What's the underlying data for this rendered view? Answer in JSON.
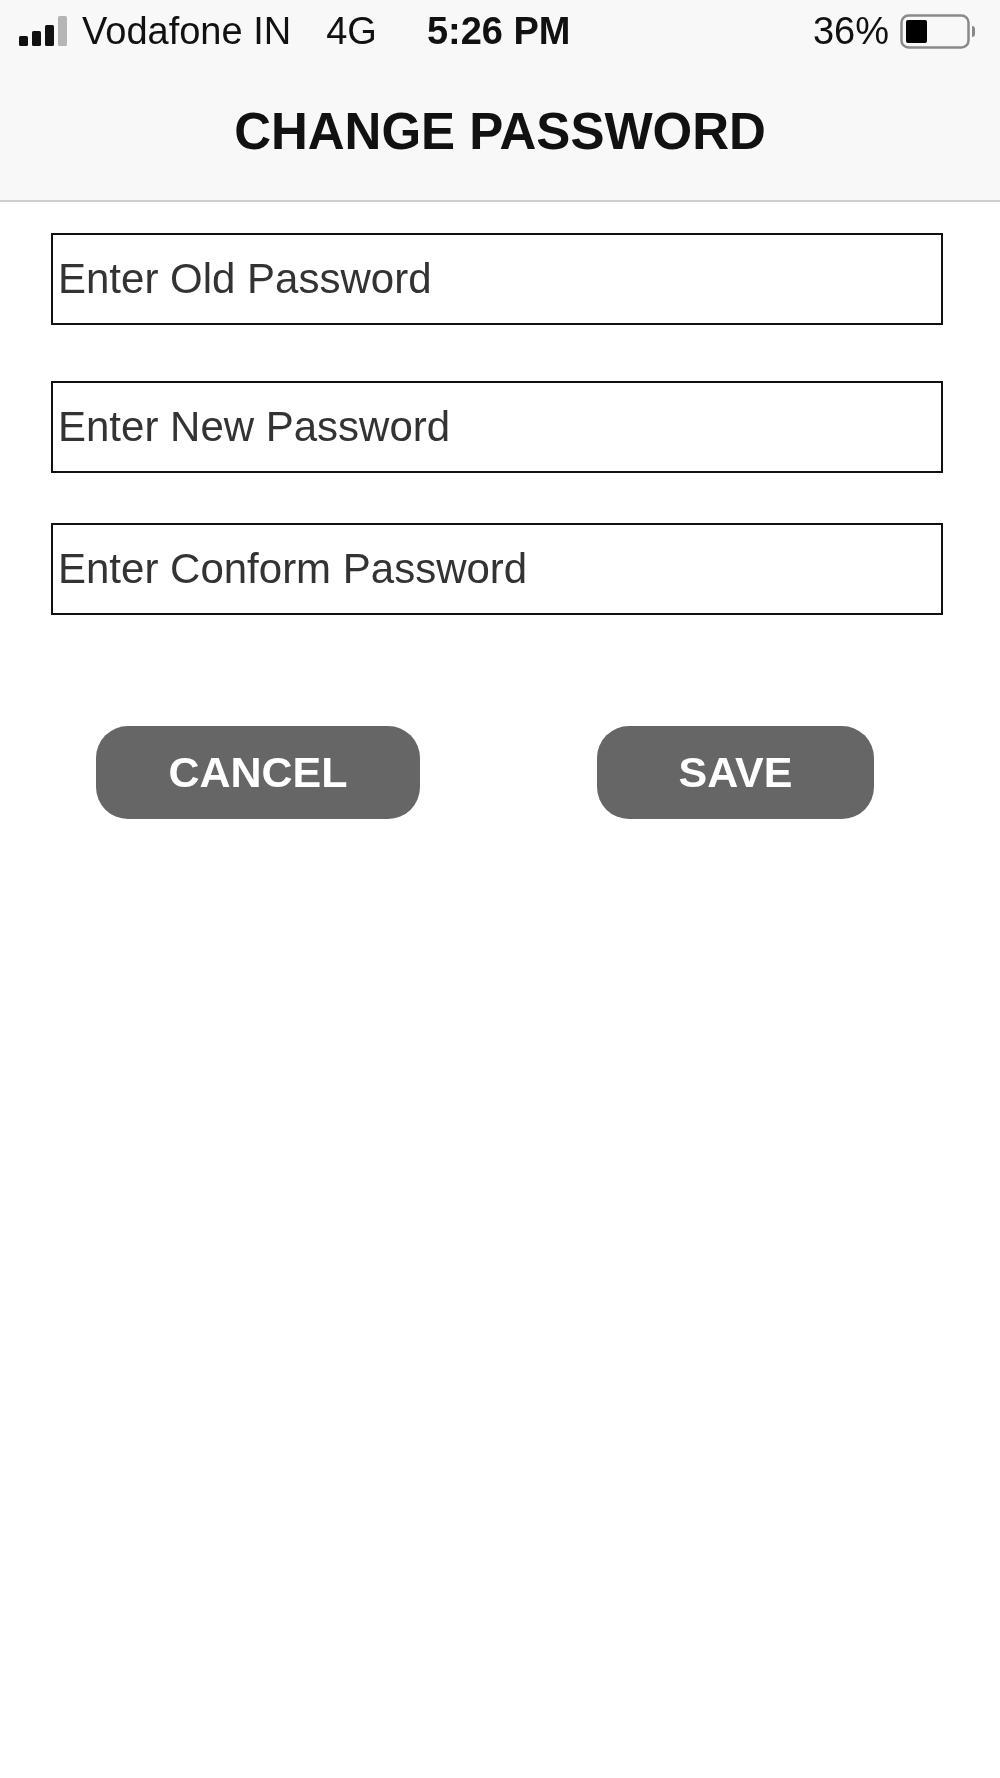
{
  "status_bar": {
    "carrier": "Vodafone IN",
    "network": "4G",
    "time": "5:26 PM",
    "battery": "36%"
  },
  "header": {
    "title": "CHANGE PASSWORD"
  },
  "fields": [
    {
      "placeholder": "Enter Old Password"
    },
    {
      "placeholder": "Enter New Password"
    },
    {
      "placeholder": "Enter Conform Password"
    }
  ],
  "buttons": [
    {
      "label": "CANCEL"
    },
    {
      "label": "SAVE"
    }
  ]
}
